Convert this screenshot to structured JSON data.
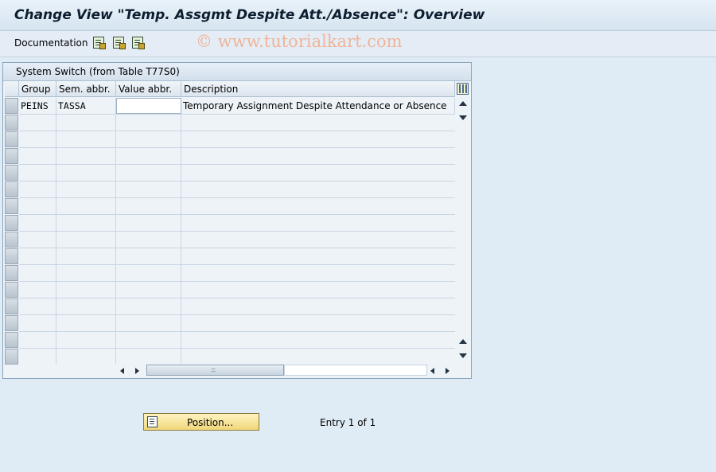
{
  "header": {
    "title": "Change View \"Temp. Assgmt Despite Att./Absence\": Overview"
  },
  "toolbar": {
    "documentation_label": "Documentation",
    "icons": [
      "doc-detail-icon",
      "doc-view-icon",
      "doc-print-icon"
    ]
  },
  "watermark": "© www.tutorialkart.com",
  "table": {
    "title": "System Switch (from Table T77S0)",
    "columns": [
      "Group",
      "Sem. abbr.",
      "Value abbr.",
      "Description"
    ],
    "rows": [
      {
        "group": "PEINS",
        "sem_abbr": "TASSA",
        "value_abbr": "",
        "description": "Temporary Assignment Despite Attendance or Absence"
      }
    ]
  },
  "footer": {
    "position_button": "Position...",
    "entry_text": "Entry 1 of 1"
  }
}
